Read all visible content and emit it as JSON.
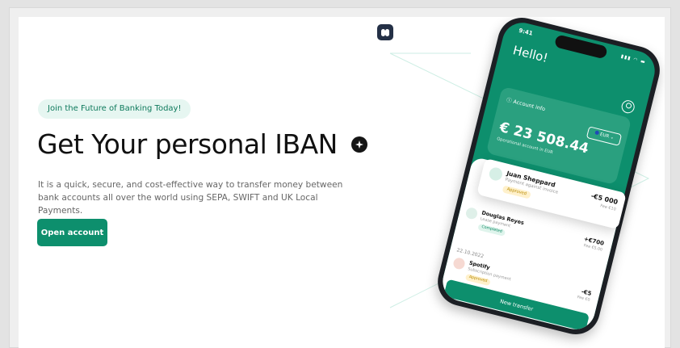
{
  "hero": {
    "badge": "Join the Future of Banking Today!",
    "headline": "Get Your personal IBAN",
    "description": "It is a quick, secure, and cost-effective way to transfer money between bank accounts all over the world using SEPA, SWIFT and UK Local Payments.",
    "cta_label": "Open account"
  },
  "icons": {
    "app_icon": "brain-icon",
    "headline_icon": "chat-sparkle-icon"
  },
  "colors": {
    "brand_green": "#0d8f6d",
    "badge_bg": "#e6f6f1",
    "app_icon_bg": "#243046"
  },
  "phone": {
    "time": "9:41",
    "greeting": "Hello!",
    "account": {
      "label": "Account info",
      "currency": "EUR",
      "balance": "€ 23 508.44",
      "subtitle": "Operational account in EUR"
    },
    "transactions": [
      {
        "name": "Juan Sheppard",
        "subtitle": "Payment against invoice",
        "status": "Approved",
        "amount": "-€5 000",
        "fee": "Fee €10"
      },
      {
        "name": "Douglas Reyes",
        "subtitle": "Lease payment",
        "status": "Completed",
        "amount": "+€700",
        "fee": "Fee €5.00"
      },
      {
        "name": "Spotify",
        "subtitle": "Subscription payment",
        "status": "Approved",
        "amount": "-€5",
        "fee": "Fee €0"
      }
    ],
    "date_label": "22.10.2022",
    "new_transfer_label": "New transfer"
  }
}
